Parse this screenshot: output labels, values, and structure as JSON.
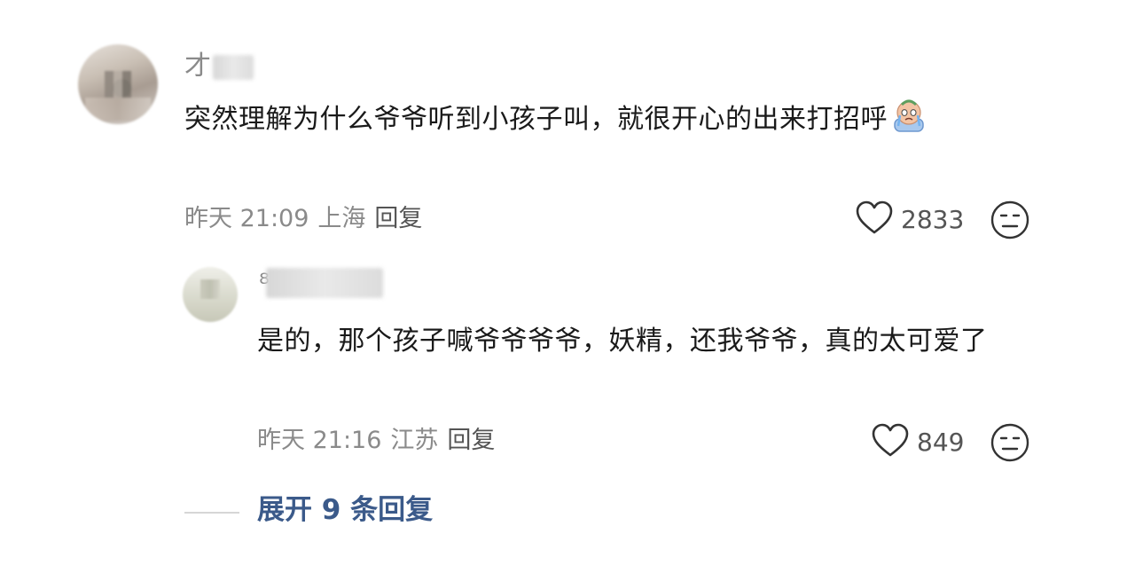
{
  "comment": {
    "username": "才",
    "text": "突然理解为什么爷爷听到小孩子叫，就很开心的出来打招呼",
    "emoji": "crying-emoji",
    "time": "昨天 21:09",
    "location": "上海",
    "reply_label": "回复",
    "likes": "2833"
  },
  "reply": {
    "username": "⁸",
    "text": "是的，那个孩子喊爷爷爷爷，妖精，还我爷爷，真的太可爱了",
    "time": "昨天 21:16",
    "location": "江苏",
    "reply_label": "回复",
    "likes": "849"
  },
  "expand": {
    "label": "展开 9 条回复"
  },
  "icons": {
    "like": "heart-outline-icon",
    "dislike": "meh-face-icon"
  },
  "colors": {
    "text": "#1a1a1a",
    "meta": "#8a8a8a",
    "link": "#3b5a8a"
  }
}
